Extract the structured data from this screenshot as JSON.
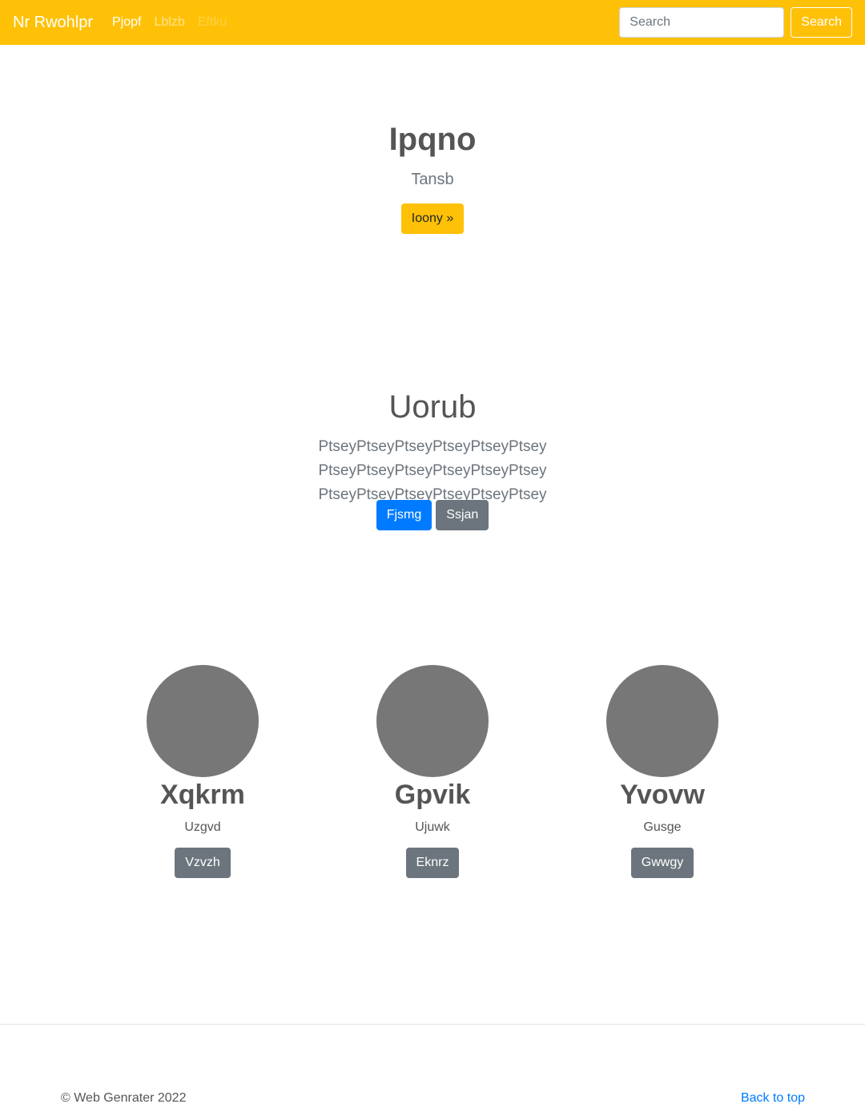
{
  "navbar": {
    "brand": "Nr Rwohlpr",
    "links": [
      "Pjopf",
      "Lblzb",
      "Eftku"
    ],
    "search_placeholder": "Search",
    "search_button": "Search"
  },
  "hero": {
    "title": "Ipqno",
    "subtitle": "Tansb",
    "button": "Ioony »"
  },
  "section": {
    "title": "Uorub",
    "lead": "PtseyPtseyPtseyPtseyPtseyPtsey PtseyPtseyPtseyPtseyPtseyPtsey PtseyPtseyPtseyPtseyPtseyPtsey",
    "primary_button": "Fjsmg",
    "secondary_button": "Ssjan"
  },
  "cards": [
    {
      "title": "Xqkrm",
      "text": "Uzgvd",
      "button": "Vzvzh"
    },
    {
      "title": "Gpvik",
      "text": "Ujuwk",
      "button": "Eknrz"
    },
    {
      "title": "Yvovw",
      "text": "Gusge",
      "button": "Gwwgy"
    }
  ],
  "footer": {
    "copyright": "© Web Genrater 2022",
    "back_to_top": "Back to top"
  },
  "colors": {
    "navbar": "#ffc107",
    "primary": "#007bff",
    "secondary": "#6c757d",
    "avatar": "#777777"
  }
}
